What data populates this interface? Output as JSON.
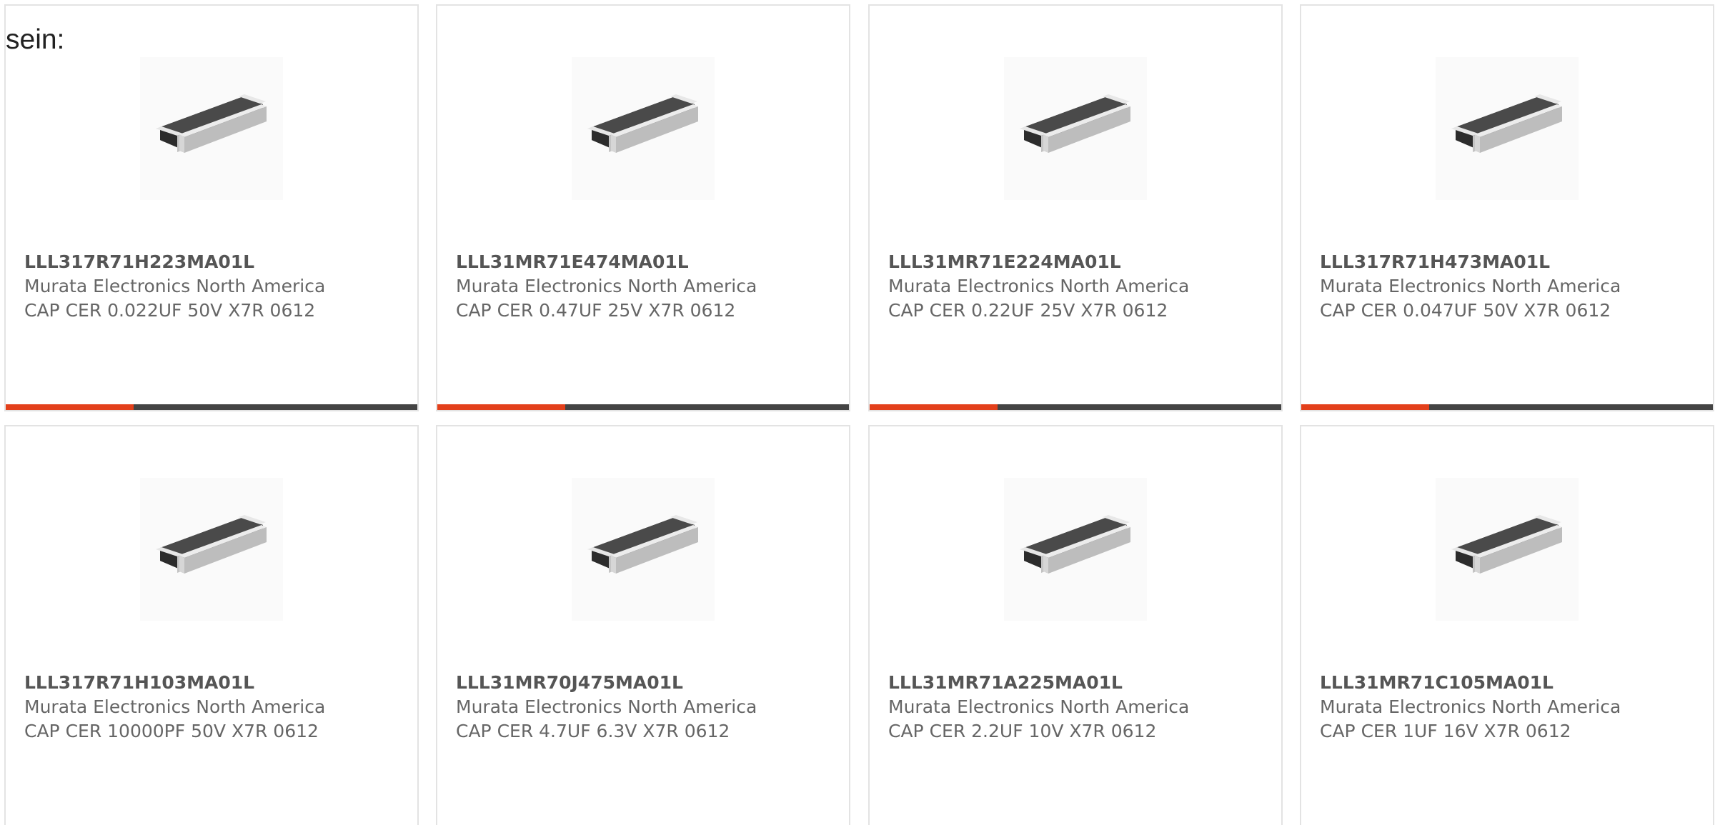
{
  "intro_text": "sein:",
  "colors": {
    "accent": "#e3401b",
    "bar_track": "#444444",
    "card_border": "#e3e3e3"
  },
  "products": [
    {
      "part_number": "LLL317R71H223MA01L",
      "manufacturer": "Murata Electronics North America",
      "description": "CAP CER 0.022UF 50V X7R 0612",
      "image_icon": "ceramic-capacitor-chip-icon",
      "progress_fraction": 0.31
    },
    {
      "part_number": "LLL31MR71E474MA01L",
      "manufacturer": "Murata Electronics North America",
      "description": "CAP CER 0.47UF 25V X7R 0612",
      "image_icon": "ceramic-capacitor-chip-icon",
      "progress_fraction": 0.31
    },
    {
      "part_number": "LLL31MR71E224MA01L",
      "manufacturer": "Murata Electronics North America",
      "description": "CAP CER 0.22UF 25V X7R 0612",
      "image_icon": "ceramic-capacitor-chip-icon",
      "progress_fraction": 0.31
    },
    {
      "part_number": "LLL317R71H473MA01L",
      "manufacturer": "Murata Electronics North America",
      "description": "CAP CER 0.047UF 50V X7R 0612",
      "image_icon": "ceramic-capacitor-chip-icon",
      "progress_fraction": 0.31
    },
    {
      "part_number": "LLL317R71H103MA01L",
      "manufacturer": "Murata Electronics North America",
      "description": "CAP CER 10000PF 50V X7R 0612",
      "image_icon": "ceramic-capacitor-chip-icon"
    },
    {
      "part_number": "LLL31MR70J475MA01L",
      "manufacturer": "Murata Electronics North America",
      "description": "CAP CER 4.7UF 6.3V X7R 0612",
      "image_icon": "ceramic-capacitor-chip-icon"
    },
    {
      "part_number": "LLL31MR71A225MA01L",
      "manufacturer": "Murata Electronics North America",
      "description": "CAP CER 2.2UF 10V X7R 0612",
      "image_icon": "ceramic-capacitor-chip-icon"
    },
    {
      "part_number": "LLL31MR71C105MA01L",
      "manufacturer": "Murata Electronics North America",
      "description": "CAP CER 1UF 16V X7R 0612",
      "image_icon": "ceramic-capacitor-chip-icon"
    }
  ]
}
